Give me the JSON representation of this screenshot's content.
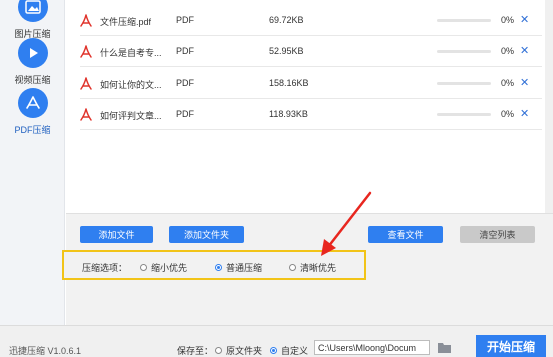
{
  "sidebar": {
    "items": [
      {
        "label": "图片压缩",
        "icon": "image-icon",
        "active": false
      },
      {
        "label": "视频压缩",
        "icon": "video-icon",
        "active": false
      },
      {
        "label": "PDF压缩",
        "icon": "pdf-icon",
        "active": true
      }
    ]
  },
  "files": [
    {
      "name": "文件压缩.pdf",
      "type": "PDF",
      "size": "69.72KB",
      "progress": 0,
      "percent": "0%"
    },
    {
      "name": "什么是自考专...",
      "type": "PDF",
      "size": "52.95KB",
      "progress": 0,
      "percent": "0%"
    },
    {
      "name": "如何让你的文...",
      "type": "PDF",
      "size": "158.16KB",
      "progress": 0,
      "percent": "0%"
    },
    {
      "name": "如何评判文章...",
      "type": "PDF",
      "size": "118.93KB",
      "progress": 0,
      "percent": "0%"
    }
  ],
  "toolbar": {
    "add_file": "添加文件",
    "add_folder": "添加文件夹",
    "view_files": "查看文件",
    "clear_list": "清空列表"
  },
  "compress_options": {
    "label": "压缩选项：",
    "options": [
      {
        "label": "缩小优先",
        "selected": false
      },
      {
        "label": "普通压缩",
        "selected": true
      },
      {
        "label": "清晰优先",
        "selected": false
      }
    ]
  },
  "status": {
    "version": "迅捷压缩 V1.0.6.1",
    "save_to": "保存至：",
    "original_folder": "原文件夹",
    "custom": "自定义",
    "custom_selected": true,
    "path": "C:\\Users\\Mloong\\Docum",
    "start": "开始压缩"
  },
  "colors": {
    "accent": "#2f7ff0",
    "highlight_border": "#f2c418",
    "arrow": "#e8261f",
    "pdf_red": "#e0332b"
  }
}
